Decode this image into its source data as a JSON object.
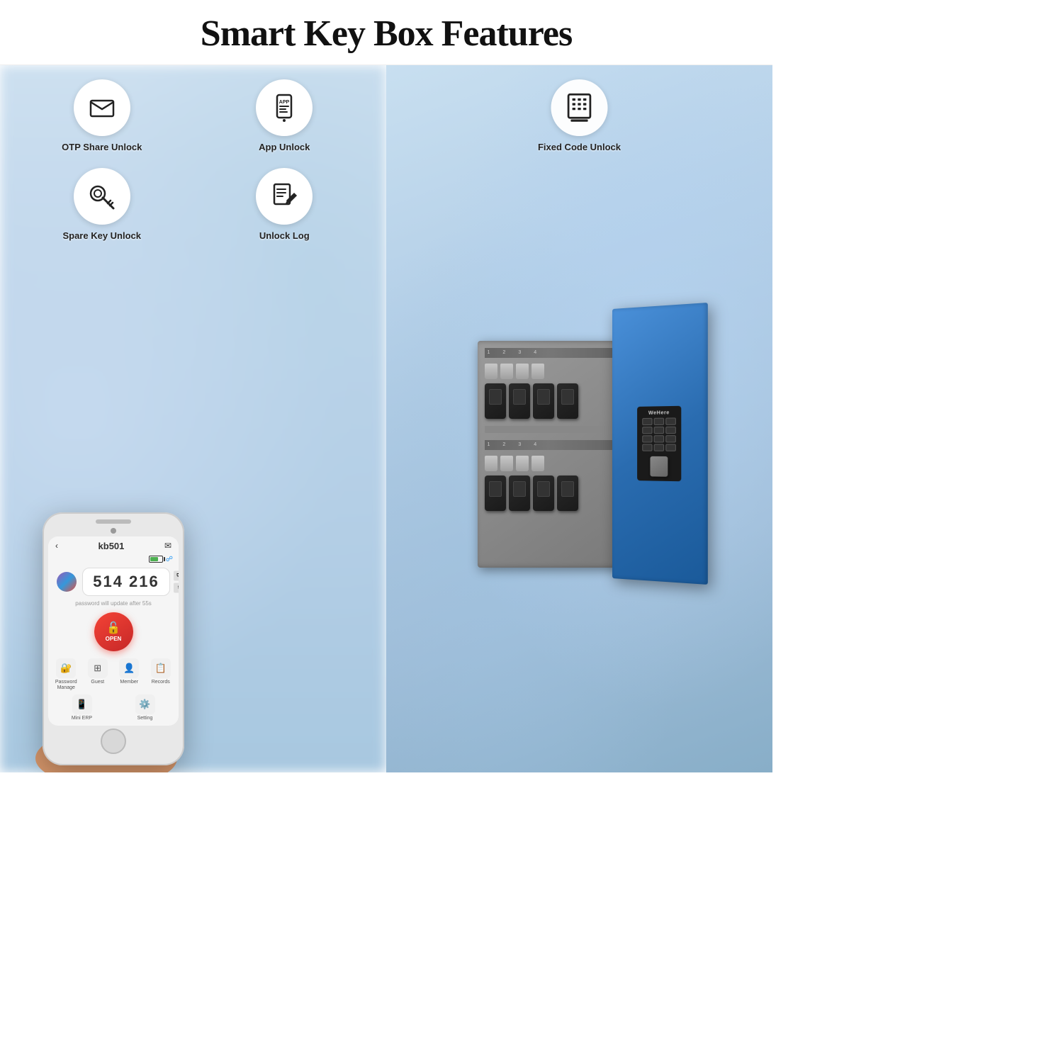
{
  "header": {
    "title": "Smart Key Box Features"
  },
  "left_panel": {
    "features": [
      {
        "id": "otp-share-unlock",
        "label": "OTP Share Unlock",
        "icon": "envelope"
      },
      {
        "id": "app-unlock",
        "label": "App Unlock",
        "icon": "mobile-app"
      },
      {
        "id": "spare-key-unlock",
        "label": "Spare Key Unlock",
        "icon": "key"
      },
      {
        "id": "unlock-log",
        "label": "Unlock Log",
        "icon": "document"
      }
    ]
  },
  "right_panel": {
    "fixed_code_label": "Fixed Code Unlock"
  },
  "phone_app": {
    "device_name": "kb501",
    "otp_code": "514 216",
    "update_text": "password will update after 55s",
    "open_button_label": "OPEN",
    "menu_items": [
      {
        "label": "Password\nManage",
        "icon": "lock"
      },
      {
        "label": "Guest",
        "icon": "grid"
      },
      {
        "label": "Member",
        "icon": "person"
      },
      {
        "label": "Records",
        "icon": "document-list"
      },
      {
        "label": "Mini ERP",
        "icon": "phone-icon"
      },
      {
        "label": "Setting",
        "icon": "gear"
      }
    ],
    "brand": "WeHere"
  },
  "colors": {
    "accent_blue": "#4a90d9",
    "open_red": "#f44336",
    "text_dark": "#222222",
    "bg_left": "#c8dce8",
    "bg_right": "#b8cfdf"
  }
}
